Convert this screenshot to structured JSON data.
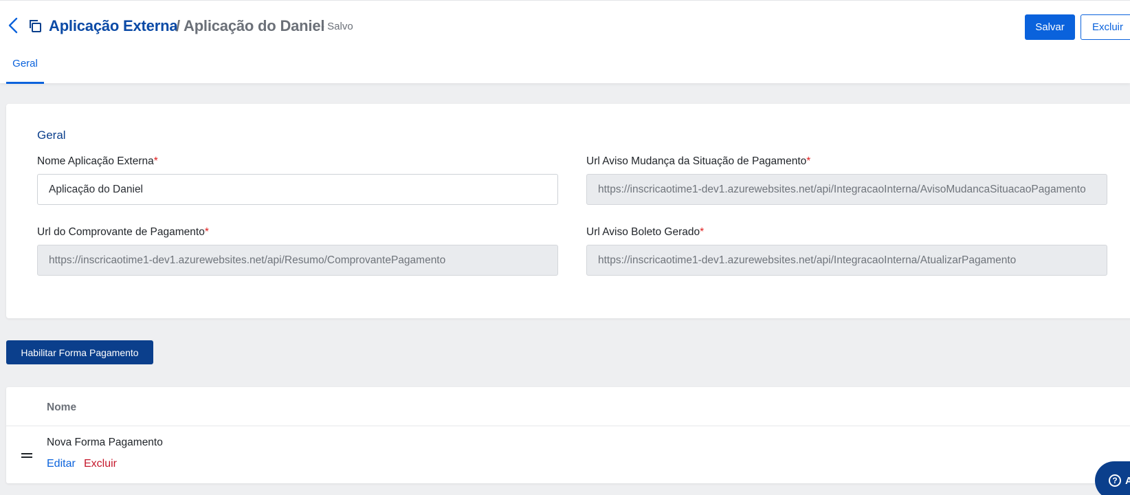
{
  "header": {
    "back_icon": "chevron-left-icon",
    "copy_icon": "copy-icon",
    "entity": "Aplicação Externa",
    "record": "/ Aplicação do Daniel",
    "status": "- Salvo",
    "save_label": "Salvar",
    "delete_label": "Excluir"
  },
  "tabs": [
    {
      "label": "Geral"
    }
  ],
  "form": {
    "section_title": "Geral",
    "nome": {
      "label": "Nome Aplicação Externa",
      "required": "*",
      "value": "Aplicação do Daniel"
    },
    "url_aviso_mudanca": {
      "label": "Url Aviso Mudança da Situação de Pagamento",
      "required": "*",
      "value": "https://inscricaotime1-dev1.azurewebsites.net/api/IntegracaoInterna/AvisoMudancaSituacaoPagamento"
    },
    "url_comprovante": {
      "label": "Url do Comprovante de Pagamento",
      "required": "*",
      "value": "https://inscricaotime1-dev1.azurewebsites.net/api/Resumo/ComprovantePagamento"
    },
    "url_boleto": {
      "label": "Url Aviso Boleto Gerado",
      "required": "*",
      "value": "https://inscricaotime1-dev1.azurewebsites.net/api/IntegracaoInterna/AtualizarPagamento"
    }
  },
  "habilitar_label": "Habilitar Forma Pagamento",
  "table": {
    "header_name": "Nome",
    "rows": [
      {
        "name": "Nova Forma Pagamento",
        "edit_label": "Editar",
        "delete_label": "Excluir"
      }
    ]
  },
  "help": {
    "icon": "question-circle-icon",
    "symbol": "?",
    "label": "A"
  },
  "colors": {
    "primary": "#0a62dc",
    "dark_primary": "#0b3f8c",
    "danger": "#c4162a",
    "required": "#e02020"
  }
}
